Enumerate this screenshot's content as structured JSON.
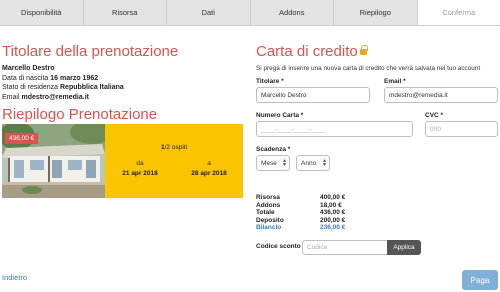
{
  "tabs": [
    {
      "label": "Disponibilità"
    },
    {
      "label": "Risorsa"
    },
    {
      "label": "Dati"
    },
    {
      "label": "Addons"
    },
    {
      "label": "Riepilogo"
    },
    {
      "label": "Conferma"
    }
  ],
  "holder": {
    "title": "Titolare della prenotazione",
    "name": "Marcello Destro",
    "birth_label": "Data di nascita",
    "birth_value": "16 marzo 1962",
    "residence_label": "Stato di residenza",
    "residence_value": "Repubblica Italiana",
    "email_label": "Email",
    "email_value": "mdestro@remedia.it"
  },
  "summary_booking": {
    "title": "Riepilogo Prenotazione",
    "price_badge": "436,00 €",
    "guests_count": "1",
    "guests_suffix": "/2 ospiti",
    "from_label": "da",
    "from_date": "21 apr 2018",
    "to_label": "a",
    "to_date": "28 apr 2018"
  },
  "credit_card": {
    "title": "Carta di credito",
    "hint": "Si prega di inserire una nuova carta di credito che verrà salvata nel tuo account",
    "holder_label": "Titolare *",
    "holder_value": "Marcello Destro",
    "email_label": "Email *",
    "email_value": "mdestro@remedia.it",
    "number_label": "Numero Carta *",
    "number_placeholder": "____-____-____-____",
    "cvc_label": "CVC *",
    "cvc_placeholder": "000",
    "expiry_label": "Scadenza *",
    "month_value": "Mese",
    "year_value": "Anno"
  },
  "totals": {
    "rows": [
      {
        "label": "Risorsa",
        "value": "400,00 €"
      },
      {
        "label": "Addons",
        "value": "18,00 €"
      },
      {
        "label": "Totale",
        "value": "436,00 €"
      },
      {
        "label": "Deposito",
        "value": "200,00 €"
      },
      {
        "label": "Bilancio",
        "value": "236,00 €"
      }
    ]
  },
  "discount": {
    "label": "Codice sconto",
    "placeholder": "Codice",
    "apply_label": "Applica"
  },
  "footer": {
    "back_label": "Indietro",
    "pay_label": "Paga"
  },
  "colors": {
    "accent_red": "#d9534f",
    "card_yellow": "#fac400",
    "link_blue": "#2f7cbf",
    "pay_button": "#7fb0d8"
  }
}
